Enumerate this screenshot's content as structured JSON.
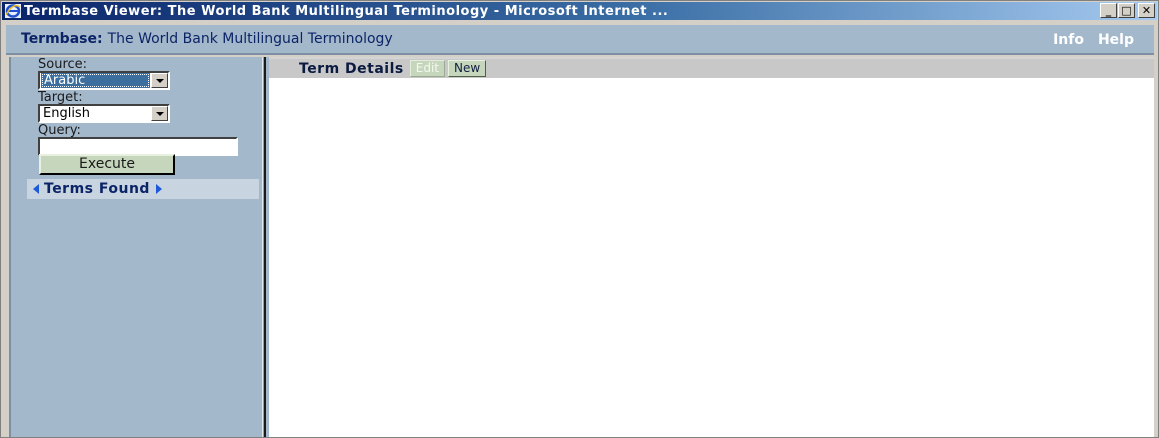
{
  "window": {
    "title": "Termbase Viewer: The World Bank Multilingual Terminology - Microsoft Internet ...",
    "buttons": {
      "minimize": "_",
      "maximize": "□",
      "close": "✕"
    }
  },
  "header": {
    "label": "Termbase:",
    "value": "The World Bank Multilingual Terminology",
    "links": [
      "Info",
      "Help"
    ]
  },
  "sidebar": {
    "source_label": "Source:",
    "source_value": "Arabic",
    "target_label": "Target:",
    "target_value": "English",
    "query_label": "Query:",
    "query_value": "",
    "execute_label": "Execute",
    "terms_found_label": "Terms Found"
  },
  "content": {
    "title": "Term Details",
    "edit_label": "Edit",
    "new_label": "New"
  },
  "colors": {
    "panel": "#a4b8cc",
    "accent_text": "#0b2466",
    "button_green": "#c6d6bc",
    "arrow_blue": "#1e5ad8"
  },
  "icons": [
    "internet-explorer-icon",
    "minimize-icon",
    "maximize-icon",
    "close-icon",
    "chevron-down-icon",
    "triangle-left-icon",
    "triangle-right-icon"
  ]
}
